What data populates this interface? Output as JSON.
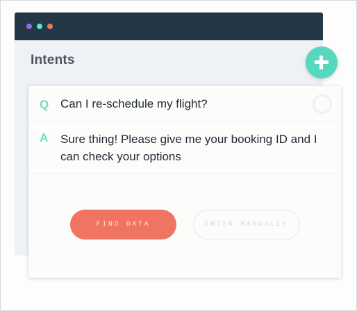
{
  "window": {
    "controls": [
      "close-dot",
      "minimize-dot",
      "maximize-dot"
    ],
    "title": "Intents"
  },
  "add_button": {
    "icon": "plus-icon"
  },
  "card": {
    "question_marker": "Q",
    "question": "Can I re-schedule my flight?",
    "answer_marker": "A",
    "answer": "Sure thing! Please give me your booking ID and I can check your options",
    "find_button_label": "FIND DATA",
    "enter_button_label": "ENTER MANUALLY"
  },
  "colors": {
    "titlebar": "#233746",
    "accent": "#55d8be",
    "primary_button": "#ef7461"
  }
}
